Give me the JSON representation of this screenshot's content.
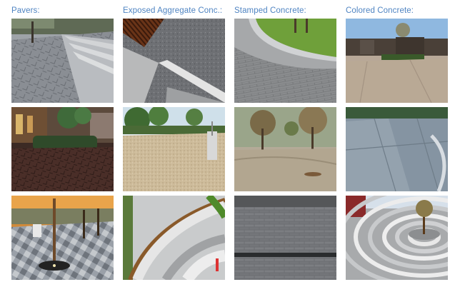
{
  "columns": [
    {
      "title": "Pavers:"
    },
    {
      "title": "Exposed Aggregate Conc.:"
    },
    {
      "title": "Stamped Concrete:"
    },
    {
      "title": "Colored Concrete:"
    }
  ]
}
